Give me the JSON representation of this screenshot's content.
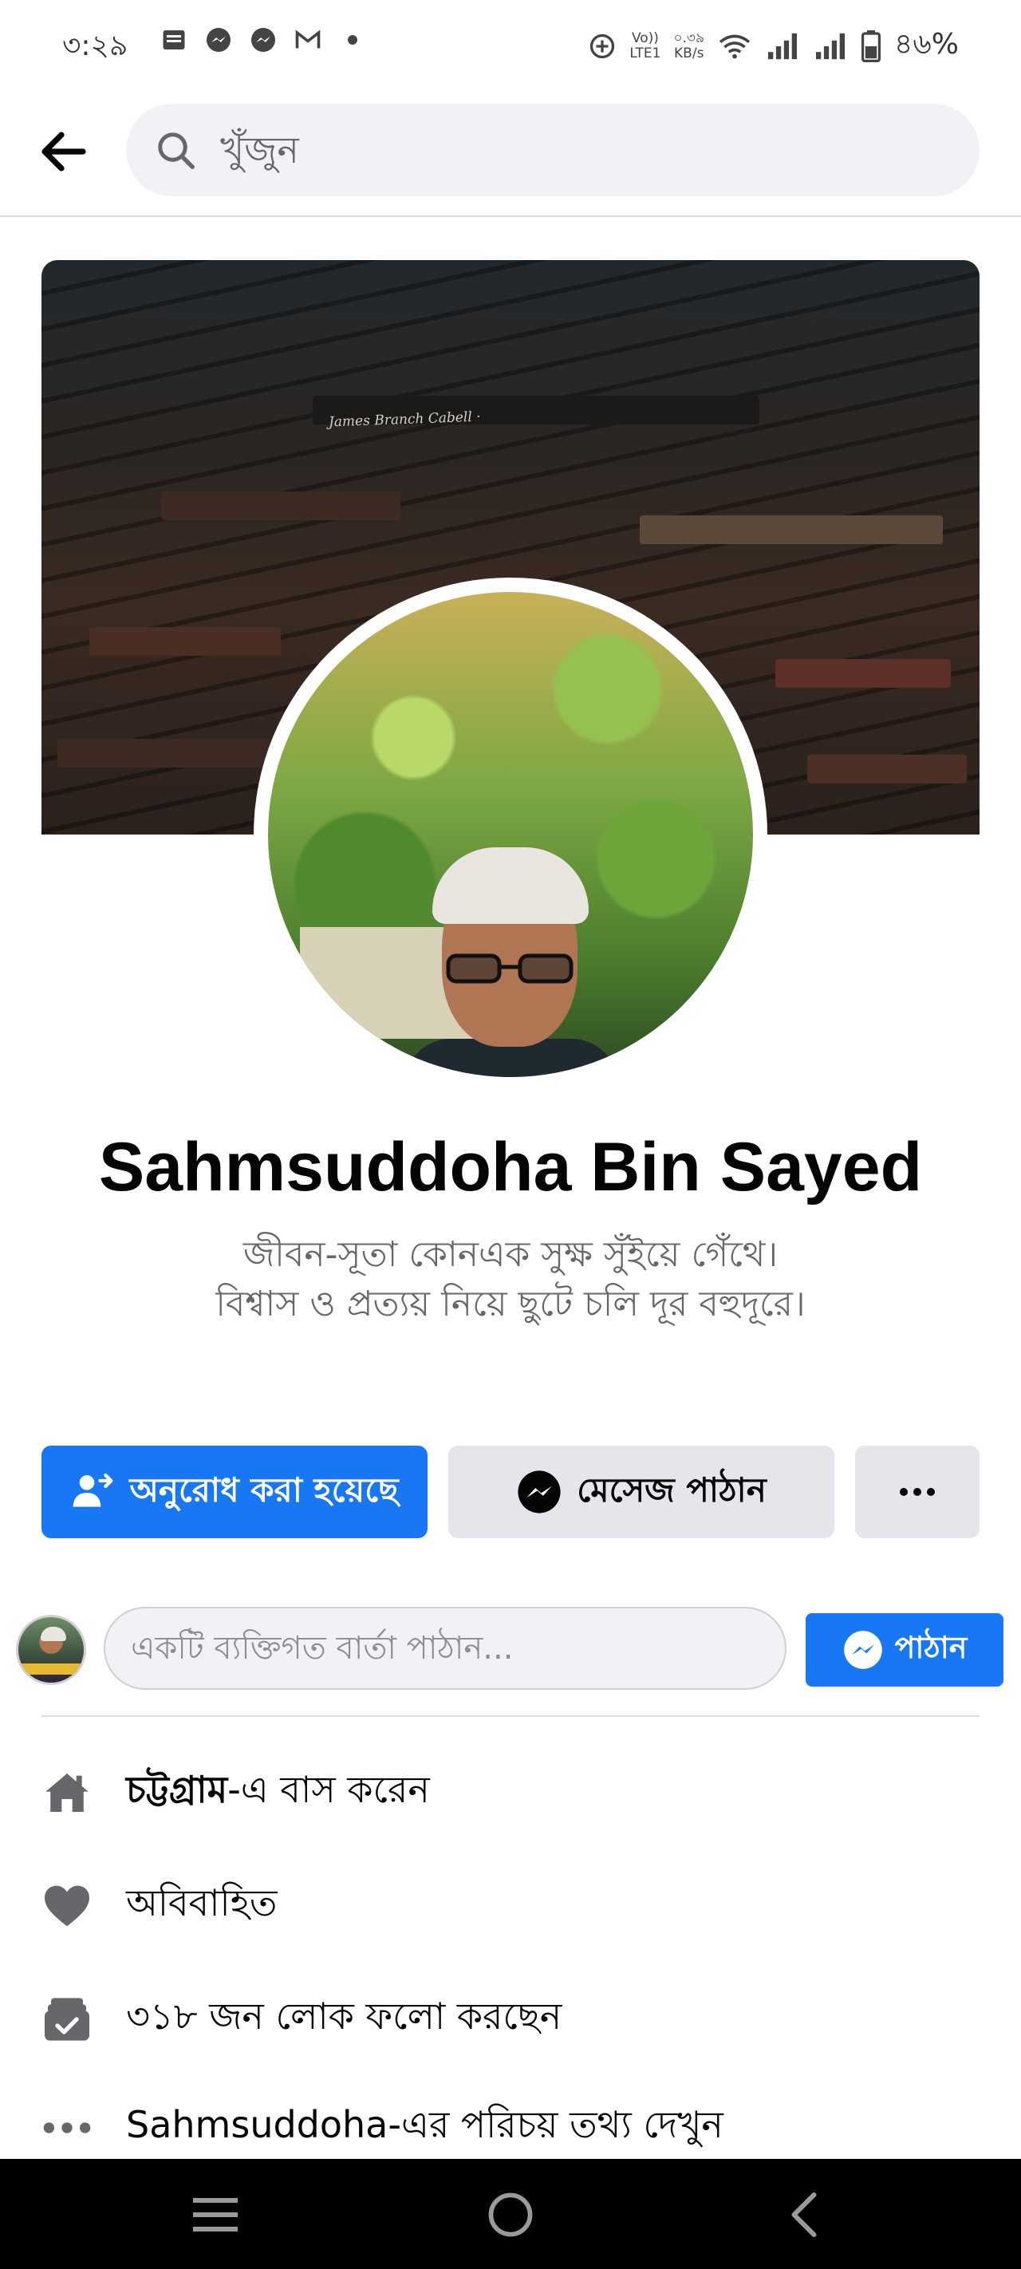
{
  "status_bar": {
    "time": "৩:২৯",
    "net_speed_value": "০.৩৯",
    "net_speed_unit": "KB/s",
    "volte_label": "Vo))",
    "lte_label": "LTE1",
    "battery": "৪৬%"
  },
  "search": {
    "placeholder": "খুঁজুন"
  },
  "profile": {
    "cover_book_title": "James Branch Cabell · ",
    "name": "Sahmsuddoha Bin Sayed",
    "bio_line1": "জীবন-সূতা কোনএক সুক্ষ সুঁইয়ে গেঁথে।",
    "bio_line2": "বিশ্বাস ও প্রত্যয় নিয়ে ছুটে চলি দূর বহুদূরে।"
  },
  "actions": {
    "requested_label": "অনুরোধ করা হয়েছে",
    "message_label": "মেসেজ পাঠান"
  },
  "composer": {
    "placeholder": "একটি ব্যক্তিগত বার্তা পাঠান...",
    "send_label": "পাঠান"
  },
  "info": {
    "lives_in_city": "চট্টগ্রাম",
    "lives_in_suffix": "-এ বাস করেন",
    "relationship": "অবিবাহিত",
    "followers": "৩১৮ জন লোক ফলো করছেন",
    "see_about": "Sahmsuddoha-এর পরিচয় তথ্য দেখুন"
  },
  "colors": {
    "accent": "#1877f2",
    "button_gray": "#e4e6eb",
    "icon_gray": "#65676b"
  }
}
